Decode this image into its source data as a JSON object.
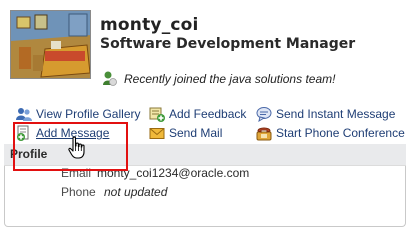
{
  "profile": {
    "name": "monty_coi",
    "title": "Software Development Manager",
    "status_message": "Recently joined the java solutions team!",
    "avatar": "bedroom-painting-photo"
  },
  "actions": {
    "view_gallery": {
      "label": "View Profile Gallery",
      "icon": "people-icon"
    },
    "add_feedback": {
      "label": "Add Feedback",
      "icon": "feedback-icon"
    },
    "send_instant": {
      "label": "Send Instant Message",
      "icon": "chat-bubble-icon"
    },
    "add_message": {
      "label": "Add Message",
      "icon": "add-message-icon"
    },
    "send_mail": {
      "label": "Send Mail",
      "icon": "envelope-icon"
    },
    "phone_conference": {
      "label": "Start Phone Conference",
      "icon": "phone-icon"
    }
  },
  "profile_section": {
    "header": "Profile",
    "email_label": "Email",
    "email_value": "monty_coi1234@oracle.com",
    "phone_label": "Phone",
    "phone_value": "not updated"
  },
  "colors": {
    "link": "#1f3e75",
    "highlight": "#e21010",
    "section_header_bg": "#e9eaec"
  }
}
